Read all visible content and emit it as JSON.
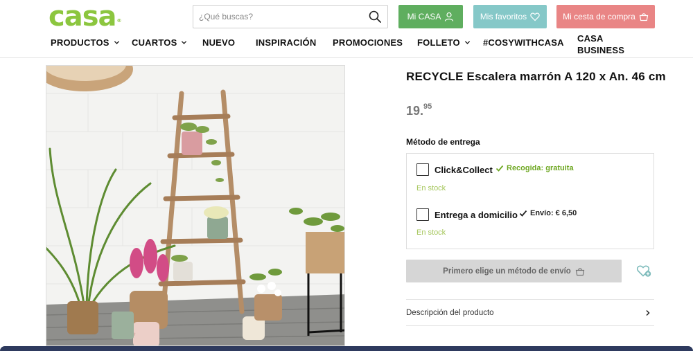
{
  "header": {
    "logo": "casa",
    "logo_mark": "®",
    "search": {
      "placeholder": "¿Qué buscas?",
      "icon": "search-icon"
    },
    "account_label": "Mi CASA",
    "favorites_label": "Mis favoritos",
    "cart_label": "Mi cesta de compra",
    "colors": {
      "brand": "#8cc63f",
      "account": "#5fae5f",
      "favorites": "#85c8c8",
      "cart": "#e98585"
    }
  },
  "nav": {
    "items": [
      {
        "label": "PRODUCTOS",
        "has_dropdown": true
      },
      {
        "label": "CUARTOS",
        "has_dropdown": true
      },
      {
        "label": "NUEVO",
        "has_dropdown": false
      },
      {
        "label": "INSPIRACIÓN",
        "has_dropdown": false
      },
      {
        "label": "PROMOCIONES",
        "has_dropdown": false
      },
      {
        "label": "FOLLETO",
        "has_dropdown": true
      },
      {
        "label": "#COSYWITHCASA",
        "has_dropdown": false
      },
      {
        "label_line1": "CASA",
        "label_line2": "BUSINESS",
        "has_dropdown": false
      }
    ]
  },
  "product": {
    "title": "RECYCLE Escalera marrón A 120 x An. 46 cm",
    "price_int": "19.",
    "price_dec": "95",
    "image_alt": "Escalera de madera con macetas y plantas"
  },
  "delivery": {
    "label": "Método de entrega",
    "options": [
      {
        "label": "Click&Collect",
        "note": "Recogida: gratuita",
        "stock": "En stock",
        "checked": false
      },
      {
        "label": "Entrega a domicilio",
        "note": "Envío: € 6,50",
        "stock": "En stock",
        "checked": false
      }
    ]
  },
  "actions": {
    "choose_method": "Primero elige un método de envío",
    "add_favorite_icon": "heart-plus-icon"
  },
  "description": {
    "label": "Descripción del producto"
  }
}
